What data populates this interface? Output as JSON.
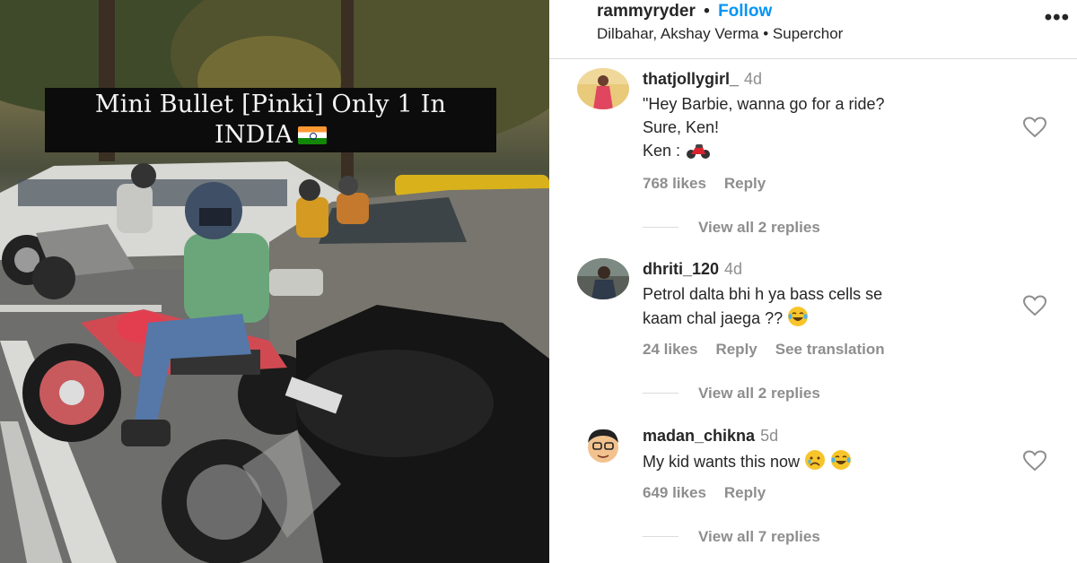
{
  "post": {
    "caption_line1": "Mini Bullet [Pinki] Only 1 In",
    "caption_line2": "INDIA"
  },
  "header": {
    "username": "rammyryder",
    "separator": "•",
    "follow_label": "Follow",
    "audio_artists": "Dilbahar, Akshay Verma",
    "audio_sep": "•",
    "audio_track": "Superchor",
    "more_label": "•••"
  },
  "comments": [
    {
      "username": "thatjollygirl_",
      "time": "4d",
      "lines": [
        "\"Hey Barbie, wanna go for a ride?",
        "Sure, Ken!",
        "Ken :"
      ],
      "likes": "768 likes",
      "reply_label": "Reply",
      "view_replies": "View all 2 replies"
    },
    {
      "username": "dhriti_120",
      "time": "4d",
      "lines": [
        "Petrol dalta bhi h ya bass cells se",
        "kaam chal jaega ??"
      ],
      "likes": "24 likes",
      "reply_label": "Reply",
      "translation_label": "See translation",
      "view_replies": "View all 2 replies"
    },
    {
      "username": "madan_chikna",
      "time": "5d",
      "lines": [
        "My kid wants this now"
      ],
      "likes": "649 likes",
      "reply_label": "Reply",
      "view_replies": "View all 7 replies"
    }
  ],
  "icons": {
    "heart": "heart-outline-icon",
    "motorcycle": "motorcycle-emoji",
    "laughing": "tears-of-joy-emoji",
    "crying": "crying-face-emoji",
    "flag": "india-flag-emoji"
  },
  "colors": {
    "follow_blue": "#0095f6",
    "meta_gray": "#8e8e8e",
    "text": "#262626"
  }
}
